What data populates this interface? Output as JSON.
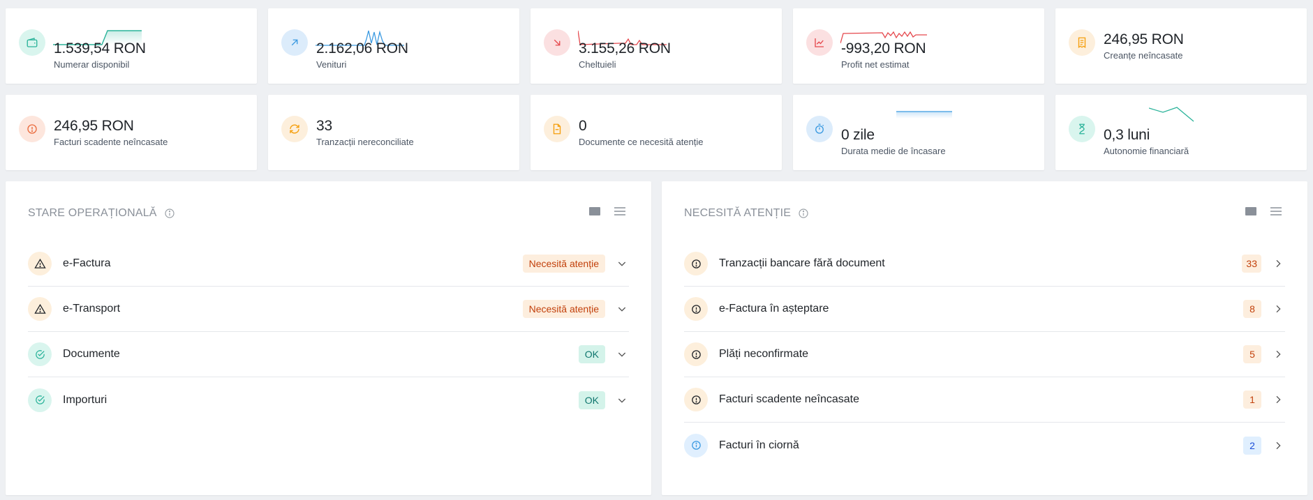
{
  "kpi_row1": [
    {
      "value": "1.539,54 RON",
      "label": "Numerar disponibil",
      "icon": "wallet-icon"
    },
    {
      "value": "2.162,06 RON",
      "label": "Venituri",
      "icon": "arrow-up-right-icon"
    },
    {
      "value": "3.155,26 RON",
      "label": "Cheltuieli",
      "icon": "arrow-down-right-icon"
    },
    {
      "value": "-993,20 RON",
      "label": "Profit net estimat",
      "icon": "chart-line-icon"
    },
    {
      "value": "246,95 RON",
      "label": "Creanțe neîncasate",
      "icon": "receipt-icon"
    }
  ],
  "kpi_row2": [
    {
      "value": "246,95 RON",
      "label": "Facturi scadente neîncasate",
      "icon": "alert-circle-icon"
    },
    {
      "value": "33",
      "label": "Tranzacții nereconciliate",
      "icon": "refresh-icon"
    },
    {
      "value": "0",
      "label": "Documente ce necesită atenție",
      "icon": "document-icon"
    },
    {
      "value": "0 zile",
      "label": "Durata medie de încasare",
      "icon": "stopwatch-icon"
    },
    {
      "value": "0,3 luni",
      "label": "Autonomie financiară",
      "icon": "hourglass-icon"
    }
  ],
  "status_panel": {
    "title": "STARE OPERAȚIONALĂ",
    "rows": [
      {
        "label": "e-Factura",
        "status": "Necesită atenție",
        "kind": "warn"
      },
      {
        "label": "e-Transport",
        "status": "Necesită atenție",
        "kind": "warn"
      },
      {
        "label": "Documente",
        "status": "OK",
        "kind": "ok"
      },
      {
        "label": "Importuri",
        "status": "OK",
        "kind": "ok"
      }
    ]
  },
  "attention_panel": {
    "title": "NECESITĂ ATENȚIE",
    "rows": [
      {
        "label": "Tranzacții bancare fără document",
        "count": "33",
        "kind": "warn"
      },
      {
        "label": "e-Factura în așteptare",
        "count": "8",
        "kind": "warn"
      },
      {
        "label": "Plăți neconfirmate",
        "count": "5",
        "kind": "warn"
      },
      {
        "label": "Facturi scadente neîncasate",
        "count": "1",
        "kind": "warn"
      },
      {
        "label": "Facturi în ciornă",
        "count": "2",
        "kind": "info"
      }
    ]
  },
  "colors": {
    "teal": "#2bb39a",
    "blue": "#3b9ae1",
    "red": "#e5484d",
    "orange": "#f59e0b",
    "amber": "#b7791f"
  }
}
